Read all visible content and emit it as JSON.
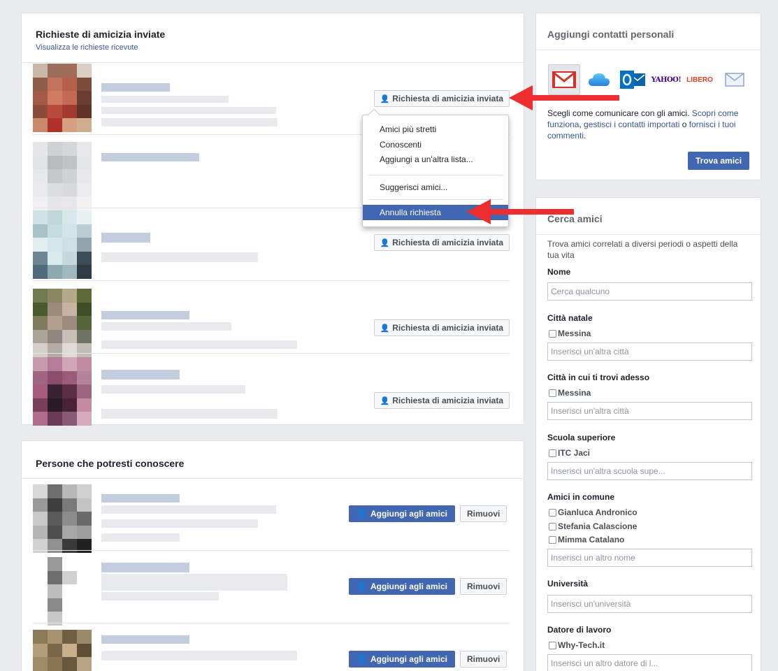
{
  "sent_requests": {
    "title": "Richieste di amicizia inviate",
    "subtitle_link": "Visualizza le richieste ricevute",
    "button_label": "Richiesta di amicizia inviata",
    "menu": {
      "items": [
        "Amici più stretti",
        "Conoscenti",
        "Aggiungi a un'altra lista...",
        "Suggerisci amici...",
        "Annulla richiesta"
      ],
      "active_item": "Annulla richiesta"
    }
  },
  "pymk": {
    "title": "Persone che potresti conoscere",
    "add_label": "Aggiungi agli amici",
    "remove_label": "Rimuovi"
  },
  "contacts": {
    "title": "Aggiungi contatti personali",
    "providers": [
      "Gmail",
      "iCloud",
      "Outlook",
      "Yahoo!",
      "Libero",
      "Email"
    ],
    "desc_prefix": "Scegli come comunicare con gli amici. ",
    "desc_link1": "Scopri come funziona",
    "desc_sep1": ", ",
    "desc_link2": "gestisci i contatti importati",
    "desc_sep2": " o ",
    "desc_link3": "fornisci i tuoi commenti",
    "desc_suffix": ".",
    "find_label": "Trova amici"
  },
  "search": {
    "title": "Cerca amici",
    "intro": "Trova amici correlati a diversi periodi o aspetti della tua vita",
    "name_label": "Nome",
    "name_placeholder": "Cerca qualcuno",
    "hometown_label": "Città natale",
    "hometown_option": "Messina",
    "hometown_placeholder": "Inserisci un'altra città",
    "current_city_label": "Città in cui ti trovi adesso",
    "current_city_option": "Messina",
    "current_city_placeholder": "Inserisci un'altra città",
    "highschool_label": "Scuola superiore",
    "highschool_option": "ITC Jaci",
    "highschool_placeholder": "Inserisci un'altra scuola supe...",
    "mutual_label": "Amici in comune",
    "mutual_options": [
      "Gianluca Andronico",
      "Stefania Calascione",
      "Mimma Catalano"
    ],
    "mutual_placeholder": "Inserisci un altro nome",
    "university_label": "Università",
    "university_placeholder": "Inserisci un'università",
    "employer_label": "Datore di lavoro",
    "employer_option": "Why-Tech.it",
    "employer_placeholder": "Inserisci un altro datore di l..."
  },
  "colors": {
    "facebook_blue": "#4267b2",
    "link": "#365899",
    "annotation_arrow": "#ee2e2e"
  }
}
